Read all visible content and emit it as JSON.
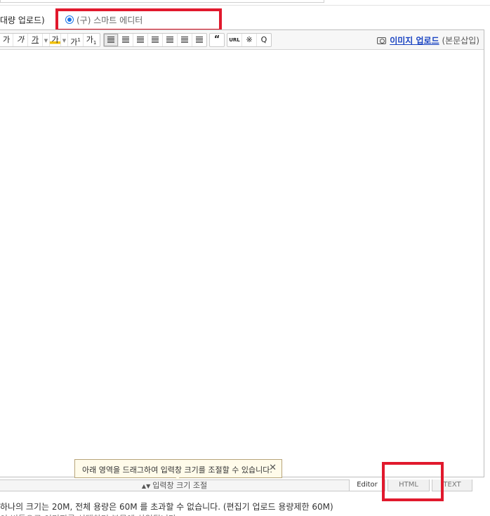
{
  "mode_selector": {
    "bulk_upload_label": "대량 업로드)",
    "smart_editor_label": "(구) 스마트 에디터"
  },
  "toolbar": {
    "font_buttons": [
      "가",
      "가",
      "가"
    ],
    "highlight_button": "가",
    "superscript_label": "가",
    "subscript_label": "가",
    "quote_label": "“",
    "url_label": "URL",
    "special_char_label": "※",
    "search_label": "Q"
  },
  "image_upload": {
    "link_label": "이미지 업로드",
    "sub_label": "(본문삽입)"
  },
  "tooltip": {
    "text": "아래 영역을 드래그하여 입력창 크기를 조절할 수 있습니다.",
    "close_label": "✕"
  },
  "resize_bar": {
    "label": "입력창 크기 조절"
  },
  "mode_tabs": [
    "Editor",
    "HTML",
    "TEXT"
  ],
  "notes": {
    "line1": "하나의 크기는 20M, 전체 용량은 60M 를 초과할 수 없습니다. (편집기 업로드 용량제한 60M)",
    "line2": "이 버튼으로 이미지를 선택하면 본문에 삽입됩니다."
  },
  "colors": {
    "highlight_red": "#e1192d",
    "link_blue": "#1a44c2",
    "radio_blue": "#1a73e8"
  }
}
